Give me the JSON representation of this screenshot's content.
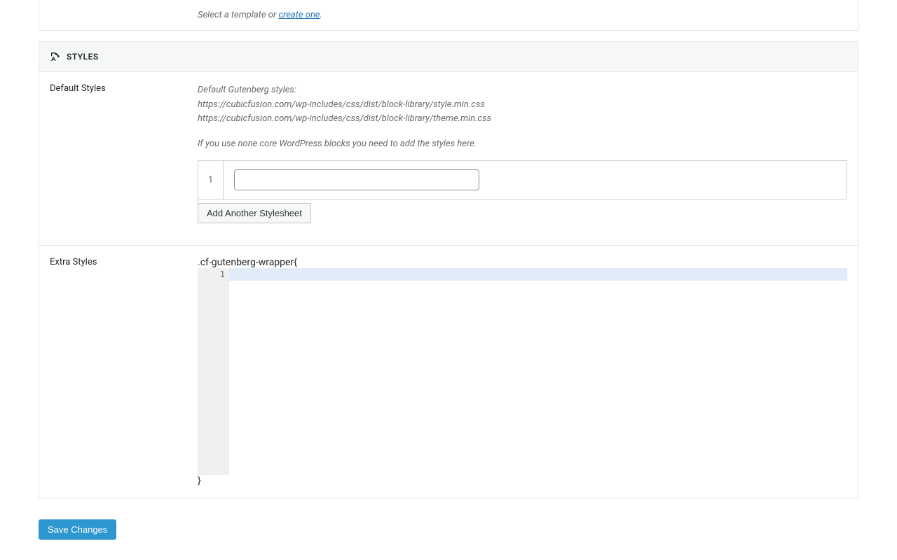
{
  "template": {
    "helper_prefix": "Select a template or ",
    "helper_link": "create one",
    "helper_suffix": "."
  },
  "styles_panel": {
    "title": "STYLES"
  },
  "default_styles": {
    "label": "Default Styles",
    "desc_line1": "Default Gutenberg styles:",
    "desc_line2": "https://cubicfusion.com/wp-includes/css/dist/block-library/style.min.css",
    "desc_line3": "https://cubicfusion.com/wp-includes/css/dist/block-library/theme.min.css",
    "desc_note": "If you use none core WordPress blocks you need to add the styles here.",
    "rows": [
      {
        "num": "1",
        "value": ""
      }
    ],
    "add_button": "Add Another Stylesheet"
  },
  "extra_styles": {
    "label": "Extra Styles",
    "prefix": ".cf-gutenberg-wrapper{",
    "gutter": "1",
    "suffix": "}"
  },
  "actions": {
    "save": "Save Changes"
  }
}
